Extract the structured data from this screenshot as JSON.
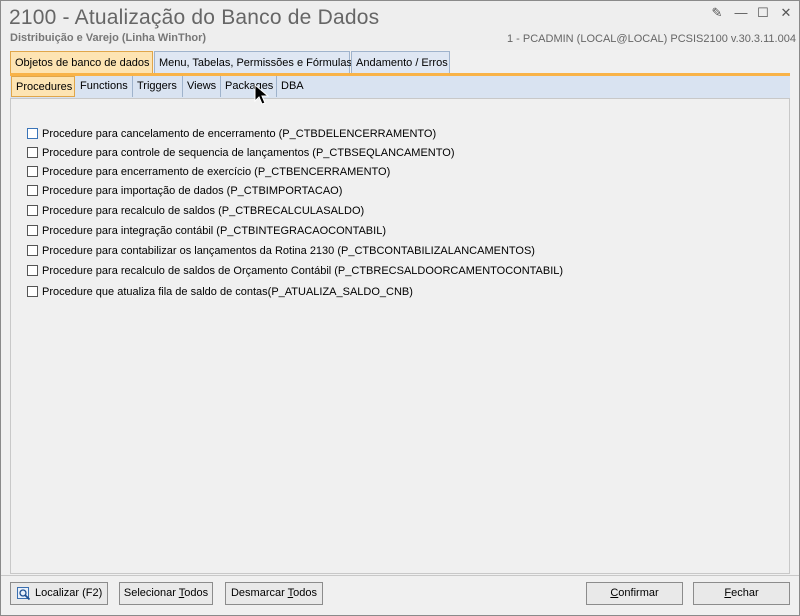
{
  "window": {
    "title": "2100 - Atualização do Banco de Dados",
    "subtitle": "Distribuição e Varejo (Linha WinThor)",
    "userinfo": "1 - PCADMIN (LOCAL@LOCAL)   PCSIS2100  v.30.3.11.004"
  },
  "main_tabs": [
    {
      "label": "Objetos de banco de dados"
    },
    {
      "label": "Menu, Tabelas, Permissões e Fórmulas"
    },
    {
      "label": "Andamento / Erros"
    }
  ],
  "sub_tabs": [
    {
      "label": "Procedures"
    },
    {
      "label": "Functions"
    },
    {
      "label": "Triggers"
    },
    {
      "label": "Views"
    },
    {
      "label": "Packages"
    },
    {
      "label": "DBA"
    }
  ],
  "procedures": [
    {
      "label": "Procedure para cancelamento de encerramento (P_CTBDELENCERRAMENTO)"
    },
    {
      "label": "Procedure para controle de sequencia de lançamentos (P_CTBSEQLANCAMENTO)"
    },
    {
      "label": "Procedure para encerramento de exercício (P_CTBENCERRAMENTO)"
    },
    {
      "label": "Procedure para importação de dados (P_CTBIMPORTACAO)"
    },
    {
      "label": "Procedure para recalculo de saldos (P_CTBRECALCULASALDO)"
    },
    {
      "label": "Procedure para integração contábil (P_CTBINTEGRACAOCONTABIL)"
    },
    {
      "label": "Procedure para contabilizar os lançamentos da Rotina 2130 (P_CTBCONTABILIZALANCAMENTOS)"
    },
    {
      "label": "Procedure para recalculo de saldos de Orçamento Contábil (P_CTBRECSALDOORCAMENTOCONTABIL)"
    },
    {
      "label": "Procedure que atualiza fila de saldo de contas(P_ATUALIZA_SALDO_CNB)"
    }
  ],
  "buttons": {
    "localizar": "Localizar (F2)",
    "selecionar_pre": "Selecionar ",
    "selecionar_u": "T",
    "selecionar_post": "odos",
    "desmarcar_pre": "Desmarcar ",
    "desmarcar_u": "T",
    "desmarcar_post": "odos",
    "confirmar_u": "C",
    "confirmar_post": "onfirmar",
    "fechar_u": "F",
    "fechar_post": "echar"
  }
}
